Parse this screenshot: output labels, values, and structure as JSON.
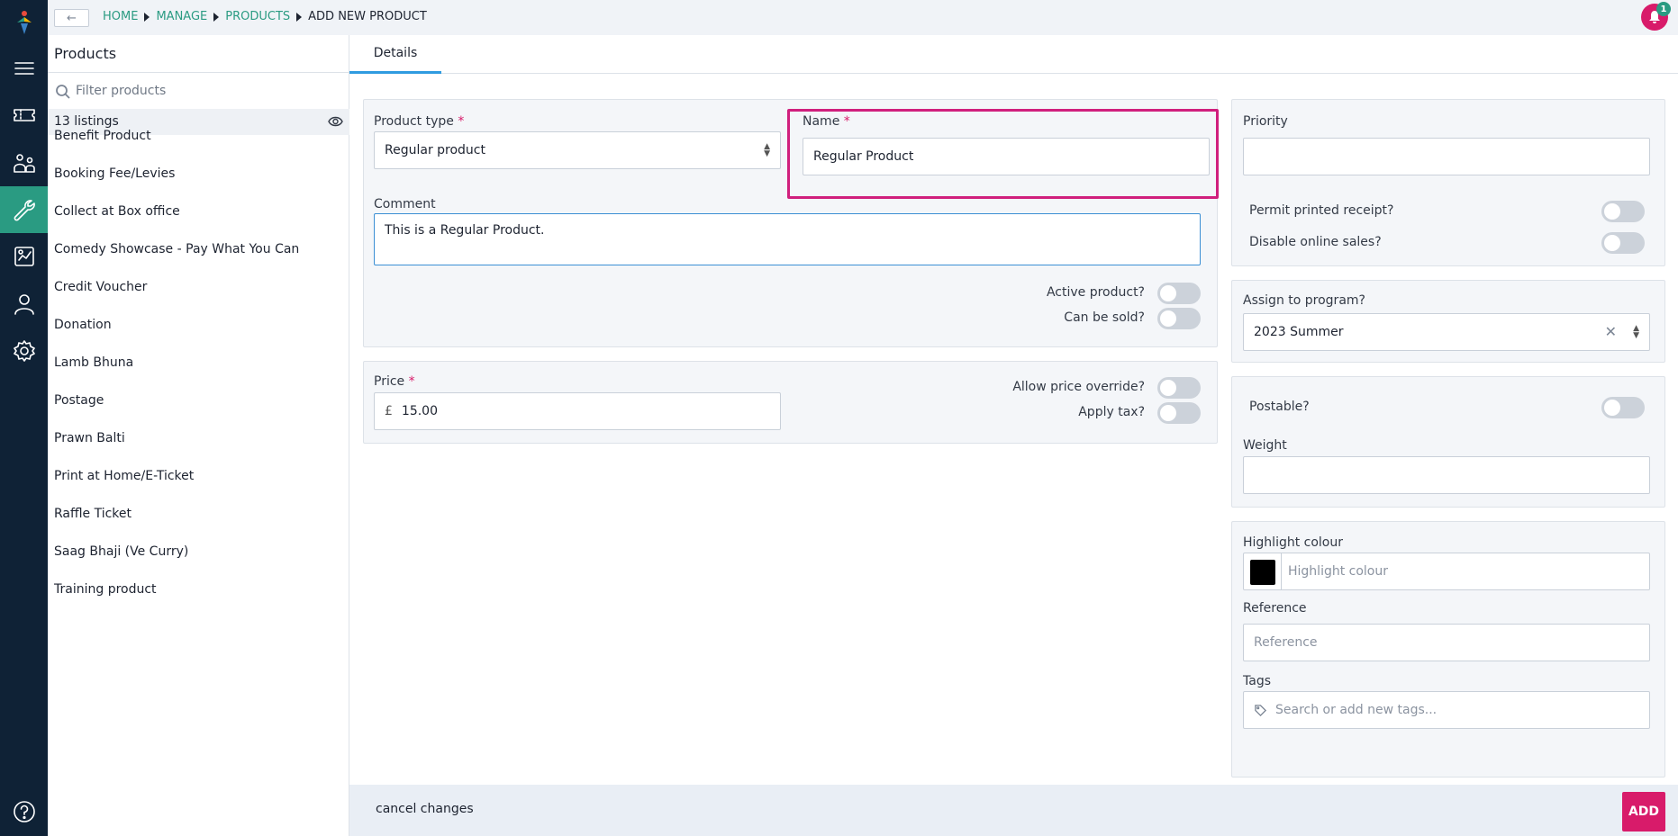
{
  "breadcrumb": {
    "items": [
      "HOME",
      "MANAGE",
      "PRODUCTS",
      "ADD NEW PRODUCT"
    ]
  },
  "notifications": {
    "count": "1"
  },
  "products_panel": {
    "title": "Products",
    "filter_placeholder": "Filter products",
    "listing_count": "13",
    "listing_word": "listings",
    "items": [
      "Benefit Product",
      "Booking Fee/Levies",
      "Collect at Box office",
      "Comedy Showcase - Pay What You Can",
      "Credit Voucher",
      "Donation",
      "Lamb Bhuna",
      "Postage",
      "Prawn Balti",
      "Print at Home/E-Ticket",
      "Raffle Ticket",
      "Saag Bhaji (Ve Curry)",
      "Training product"
    ]
  },
  "tabs": {
    "details": "Details"
  },
  "form": {
    "product_type_label": "Product type",
    "product_type_value": "Regular product",
    "name_label": "Name",
    "name_value": "Regular Product",
    "comment_label": "Comment",
    "comment_value": "This is a Regular Product.",
    "active_label": "Active product?",
    "can_be_sold_label": "Can be sold?",
    "price_label": "Price",
    "currency_symbol": "£",
    "price_value": "15.00",
    "allow_override_label": "Allow price override?",
    "apply_tax_label": "Apply tax?",
    "required_mark": "*",
    "priority_label": "Priority",
    "priority_value": "",
    "permit_receipt_label": "Permit printed receipt?",
    "disable_online_label": "Disable online sales?",
    "program_label": "Assign to program?",
    "program_value": "2023 Summer",
    "postable_label": "Postable?",
    "weight_label": "Weight",
    "weight_value": "",
    "highlight_label": "Highlight colour",
    "highlight_placeholder": "Highlight colour",
    "highlight_swatch_color": "#000000",
    "reference_label": "Reference",
    "reference_placeholder": "Reference",
    "tags_label": "Tags",
    "tags_placeholder": "Search or add new tags..."
  },
  "footer": {
    "cancel_label": "cancel changes",
    "add_label": "ADD"
  },
  "colors": {
    "brand_green": "#2a9b82",
    "accent_pink": "#d81b6a",
    "tab_blue": "#2f9be0",
    "rail_bg": "#0f2236"
  }
}
